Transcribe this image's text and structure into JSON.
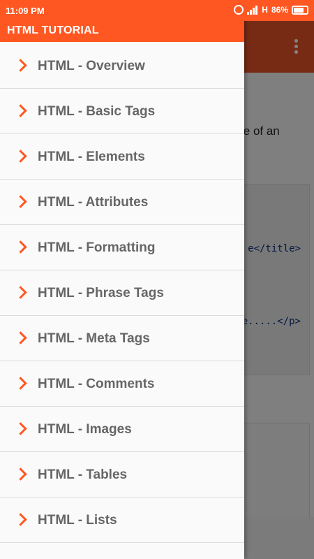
{
  "status_bar": {
    "time": "11:09 PM",
    "network": "H",
    "battery": "86%"
  },
  "drawer": {
    "title": "HTML TUTORIAL",
    "items": [
      {
        "label": "HTML - Overview",
        "icon": "chevron-right-icon"
      },
      {
        "label": "HTML - Basic Tags",
        "icon": "chevron-right-icon"
      },
      {
        "label": "HTML - Elements",
        "icon": "chevron-right-icon"
      },
      {
        "label": "HTML - Attributes",
        "icon": "chevron-right-icon"
      },
      {
        "label": "HTML - Formatting",
        "icon": "chevron-right-icon"
      },
      {
        "label": "HTML - Phrase Tags",
        "icon": "chevron-right-icon"
      },
      {
        "label": "HTML - Meta Tags",
        "icon": "chevron-right-icon"
      },
      {
        "label": "HTML - Comments",
        "icon": "chevron-right-icon"
      },
      {
        "label": "HTML - Images",
        "icon": "chevron-right-icon"
      },
      {
        "label": "HTML - Tables",
        "icon": "chevron-right-icon"
      },
      {
        "label": "HTML - Lists",
        "icon": "chevron-right-icon"
      }
    ]
  },
  "background_content": {
    "text_fragment": "le of an",
    "code_lines": [
      "e</title>",
      "e.....</p>"
    ]
  },
  "colors": {
    "accent": "#ff5722",
    "drawer_text": "#666666",
    "code_text": "#0b2f7a"
  }
}
